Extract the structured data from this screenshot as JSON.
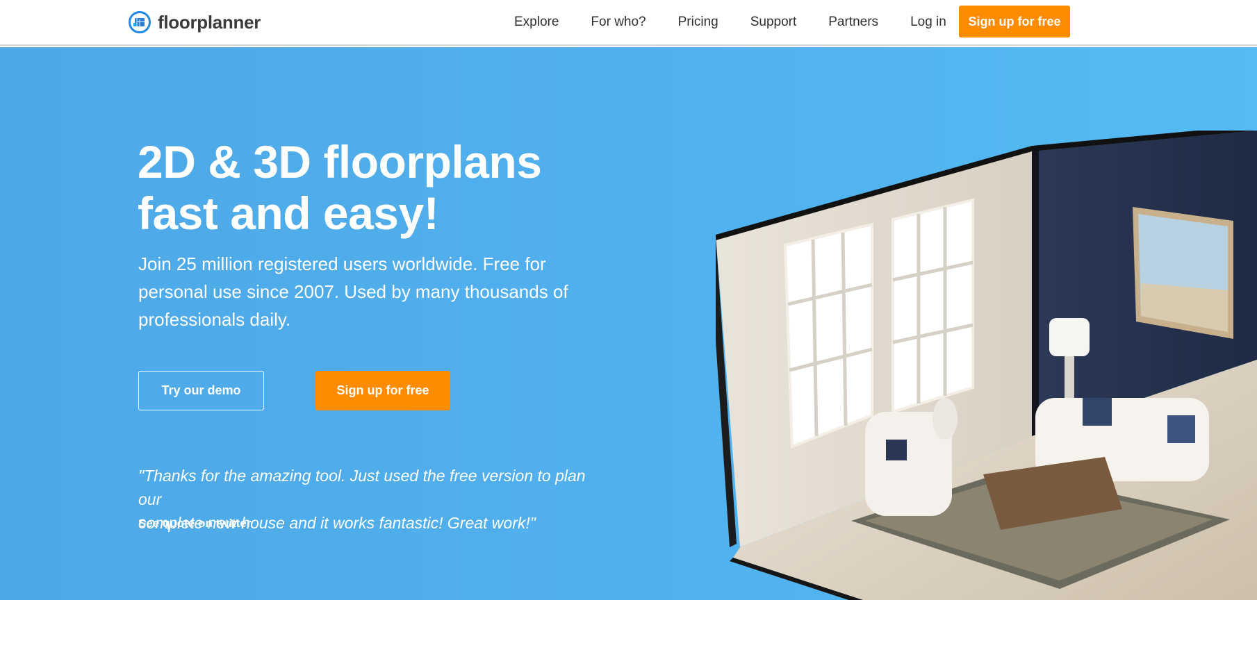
{
  "brand": {
    "name": "floorplanner",
    "accent": "#ff8c00",
    "hero_bg": "#50b1ee",
    "logo_ring": "#1e88e5"
  },
  "nav": {
    "links": [
      "Explore",
      "For who?",
      "Pricing",
      "Support",
      "Partners",
      "Log in"
    ],
    "cta_label": "Sign up for free"
  },
  "hero": {
    "headline_line1": "2D & 3D floorplans",
    "headline_line2": "fast and easy!",
    "subtext": "Join 25 million registered users worldwide. Free for personal use since 2007. Used by many thousands of professionals daily.",
    "demo_button": "Try our demo",
    "signup_button": "Sign up for free",
    "quote_line1": "\"Thanks for the amazing tool. Just used the free version to plan our",
    "quote_line2": "complete new house and it works fantastic! Great work!\"",
    "quote_link": "See quote on twitter"
  }
}
